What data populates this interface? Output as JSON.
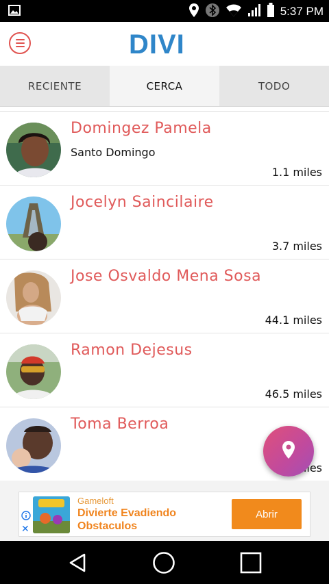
{
  "status_bar": {
    "time": "5:37 PM",
    "icons": [
      "image-icon",
      "location-icon",
      "bluetooth-icon",
      "wifi-icon",
      "signal-icon",
      "battery-icon"
    ]
  },
  "app": {
    "logo": "DIVI",
    "accent_color": "#e05a5a",
    "logo_color": "#2f86c9"
  },
  "tabs": [
    {
      "label": "RECIENTE",
      "active": false
    },
    {
      "label": "CERCA",
      "active": true
    },
    {
      "label": "TODO",
      "active": false
    }
  ],
  "people": [
    {
      "name": "Domingez Pamela",
      "city": "Santo Domingo",
      "distance": "1.1 miles"
    },
    {
      "name": "Jocelyn Saincilaire",
      "city": "",
      "distance": "3.7 miles"
    },
    {
      "name": "Jose Osvaldo Mena Sosa",
      "city": "",
      "distance": "44.1 miles"
    },
    {
      "name": "Ramon Dejesus",
      "city": "",
      "distance": "46.5 miles"
    },
    {
      "name": "Toma Berroa",
      "city": "",
      "distance": "7_ miles"
    }
  ],
  "fab": {
    "icon": "location-pin-icon"
  },
  "ad": {
    "brand": "Gameloft",
    "title": "Divierte Evadiendo Obstaculos",
    "button": "Abrir"
  }
}
